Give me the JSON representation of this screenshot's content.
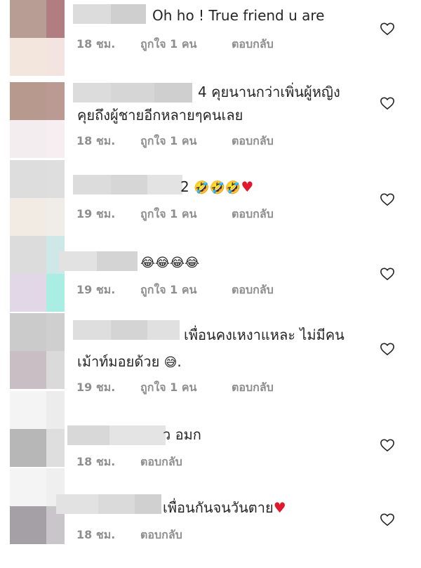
{
  "comments": [
    {
      "pre": "",
      "text": "Oh ho ! True friend u are",
      "emoji": "",
      "text2": "",
      "time": "18 ชม.",
      "likes": "ถูกใจ 1 คน",
      "reply": "ตอบกลับ"
    },
    {
      "pre": "4",
      "text": "คุยนานกว่าเพิ่นผู้หญิง",
      "text2": "คุยถึงผู้ชายอีกหลายๆคนเลย",
      "emoji": "",
      "time": "18 ชม.",
      "likes": "ถูกใจ 1 คน",
      "reply": "ตอบกลับ"
    },
    {
      "pre": "2",
      "text": "",
      "emoji": "🤣🤣🤣",
      "heart": "♥",
      "text2": "",
      "time": "19 ชม.",
      "likes": "ถูกใจ 1 คน",
      "reply": "ตอบกลับ"
    },
    {
      "pre": "",
      "text": "",
      "emoji": "😂😂😂😂",
      "text2": "",
      "time": "19 ชม.",
      "likes": "ถูกใจ 1 คน",
      "reply": "ตอบกลับ"
    },
    {
      "pre": "",
      "text": "เพื่อนคงเหงาแหละ ไม่มีคน",
      "text2": "เม้าท์มอยด้วย",
      "emoji2": "😅",
      "tail": ".",
      "time": "19 ชม.",
      "likes": "ถูกใจ 1 คน",
      "reply": "ตอบกลับ"
    },
    {
      "pre": "ว",
      "text": "อมก",
      "emoji": "",
      "text2": "",
      "time": "18 ชม.",
      "likes": "",
      "reply": "ตอบกลับ"
    },
    {
      "pre": "",
      "text": "เพื่อนกันจนวันตาย",
      "heart": "♥",
      "emoji": "",
      "text2": "",
      "time": "18 ชม.",
      "likes": "",
      "reply": "ตอบกลับ"
    }
  ],
  "icons": {
    "heart": "heart-outline-icon"
  },
  "colors": {
    "text": "#262626",
    "meta": "#8e8e8e",
    "heart_red": "#e0182d"
  }
}
